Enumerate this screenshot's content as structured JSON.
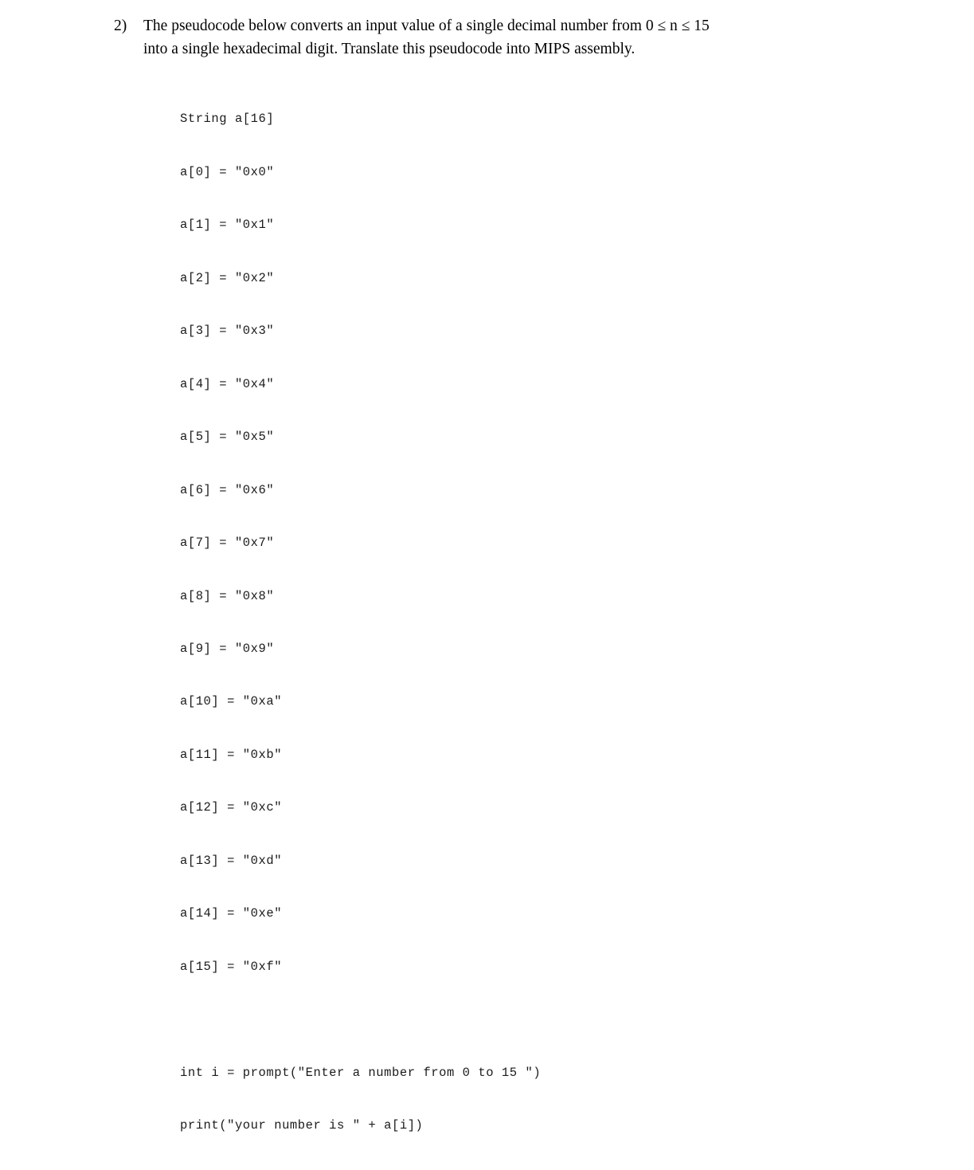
{
  "question": {
    "number": "2)",
    "line1_before_math": "The pseudocode below converts an input value of a single decimal number from ",
    "math_expression": "0 ≤ n ≤ 15",
    "line2": "into a single hexadecimal digit.  Translate this pseudocode into MIPS assembly."
  },
  "code": {
    "lines": [
      "String a[16]",
      "a[0] = \"0x0\"",
      "a[1] = \"0x1\"",
      "a[2] = \"0x2\"",
      "a[3] = \"0x3\"",
      "a[4] = \"0x4\"",
      "a[5] = \"0x5\"",
      "a[6] = \"0x6\"",
      "a[7] = \"0x7\"",
      "a[8] = \"0x8\"",
      "a[9] = \"0x9\"",
      "a[10] = \"0xa\"",
      "a[11] = \"0xb\"",
      "a[12] = \"0xc\"",
      "a[13] = \"0xd\"",
      "a[14] = \"0xe\"",
      "a[15] = \"0xf\"",
      "",
      "int i = prompt(\"Enter a number from 0 to 15 \")",
      "print(\"your number is \" + a[i])"
    ]
  },
  "colors": {
    "page_background": "#ffffff",
    "body_text": "#000000",
    "code_text": "#1b1b1b"
  }
}
